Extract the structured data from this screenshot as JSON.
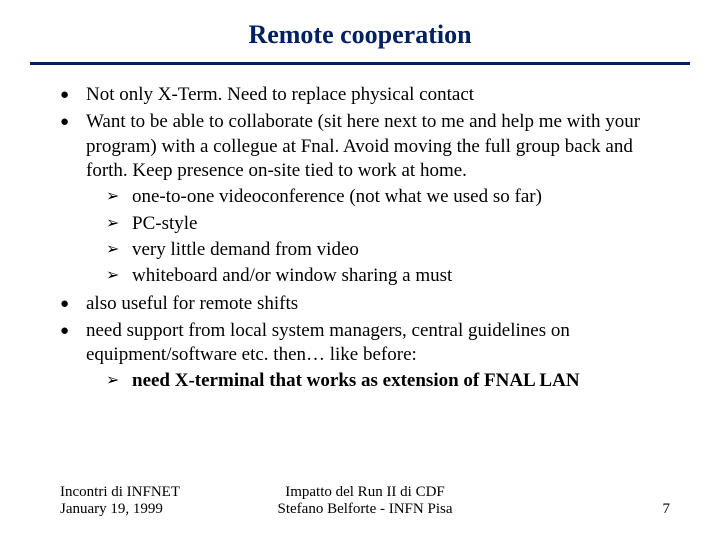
{
  "title": "Remote cooperation",
  "bullets": {
    "b0": "Not only X-Term. Need to replace physical contact",
    "b1": "Want to be able to collaborate (sit here next to me and help me with your program) with a collegue at Fnal. Avoid moving the full group back and forth. Keep presence on-site tied to work at home.",
    "b1_sub": {
      "s0": "one-to-one videoconference (not what we used so far)",
      "s1": "PC-style",
      "s2": "very little demand from video",
      "s3": "whiteboard and/or window sharing a must"
    },
    "b2": "also useful for remote shifts",
    "b3": "need support from local system managers, central guidelines on equipment/software etc. then… like before:",
    "b3_sub": {
      "s0": " need X-terminal that works as extension of FNAL LAN"
    }
  },
  "footer": {
    "left_line1": "Incontri di INFNET",
    "left_line2": "January 19, 1999",
    "center_line1": "Impatto del Run II di CDF",
    "center_line2": "Stefano Belforte - INFN Pisa",
    "page": "7"
  }
}
